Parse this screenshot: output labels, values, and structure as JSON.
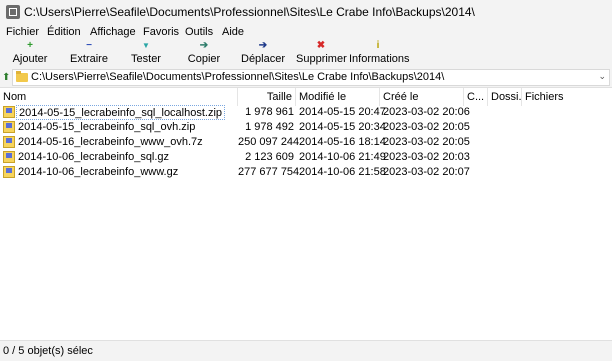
{
  "window": {
    "title": "C:\\Users\\Pierre\\Seafile\\Documents\\Professionnel\\Sites\\Le Crabe Info\\Backups\\2014\\"
  },
  "menu": [
    "Fichier",
    "Édition",
    "Affichage",
    "Favoris",
    "Outils",
    "Aide"
  ],
  "toolbar": [
    {
      "label": "Ajouter",
      "icon": "plus-icon",
      "glyph": "+",
      "color": "#2e9b2e"
    },
    {
      "label": "Extraire",
      "icon": "minus-icon",
      "glyph": "−",
      "color": "#2f4fb8"
    },
    {
      "label": "Tester",
      "icon": "check-icon",
      "glyph": "▼",
      "color": "#2aa6a6"
    },
    {
      "label": "Copier",
      "icon": "copy-arrow-icon",
      "glyph": "➔",
      "color": "#2e7d6b"
    },
    {
      "label": "Déplacer",
      "icon": "move-arrow-icon",
      "glyph": "➔",
      "color": "#1f3a8a"
    },
    {
      "label": "Supprimer",
      "icon": "delete-icon",
      "glyph": "✖",
      "color": "#d62828"
    },
    {
      "label": "Informations",
      "icon": "info-icon",
      "glyph": "i",
      "color": "#b7a000"
    }
  ],
  "address": {
    "path": "C:\\Users\\Pierre\\Seafile\\Documents\\Professionnel\\Sites\\Le Crabe Info\\Backups\\2014\\"
  },
  "columns": [
    "Nom",
    "Taille",
    "Modifié le",
    "Créé le",
    "C...",
    "Dossi...",
    "Fichiers"
  ],
  "files": [
    {
      "name": "2014-05-15_lecrabeinfo_sql_localhost.zip",
      "size": "1 978 961",
      "modified": "2014-05-15 20:47",
      "created": "2023-03-02 20:06"
    },
    {
      "name": "2014-05-15_lecrabeinfo_sql_ovh.zip",
      "size": "1 978 492",
      "modified": "2014-05-15 20:34",
      "created": "2023-03-02 20:05"
    },
    {
      "name": "2014-05-16_lecrabeinfo_www_ovh.7z",
      "size": "250 097 244",
      "modified": "2014-05-16 18:14",
      "created": "2023-03-02 20:05"
    },
    {
      "name": "2014-10-06_lecrabeinfo_sql.gz",
      "size": "2 123 609",
      "modified": "2014-10-06 21:49",
      "created": "2023-03-02 20:03"
    },
    {
      "name": "2014-10-06_lecrabeinfo_www.gz",
      "size": "277 677 754",
      "modified": "2014-10-06 21:58",
      "created": "2023-03-02 20:07"
    }
  ],
  "status": {
    "text": "0 / 5 objet(s) sélec"
  }
}
